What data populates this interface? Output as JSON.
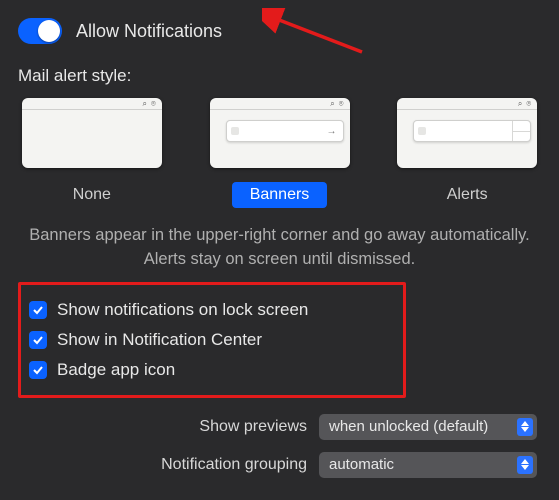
{
  "toggle": {
    "label": "Allow Notifications",
    "on": true
  },
  "section_label": "Mail alert style:",
  "styles": [
    {
      "label": "None",
      "selected": false
    },
    {
      "label": "Banners",
      "selected": true
    },
    {
      "label": "Alerts",
      "selected": false
    }
  ],
  "description": "Banners appear in the upper-right corner and go away automatically. Alerts stay on screen until dismissed.",
  "checkboxes": [
    {
      "label": "Show notifications on lock screen",
      "checked": true
    },
    {
      "label": "Show in Notification Center",
      "checked": true
    },
    {
      "label": "Badge app icon",
      "checked": true
    }
  ],
  "selects": {
    "previews": {
      "label": "Show previews",
      "value": "when unlocked (default)"
    },
    "grouping": {
      "label": "Notification grouping",
      "value": "automatic"
    }
  },
  "annotation": {
    "arrow_color": "#e31b1b"
  }
}
